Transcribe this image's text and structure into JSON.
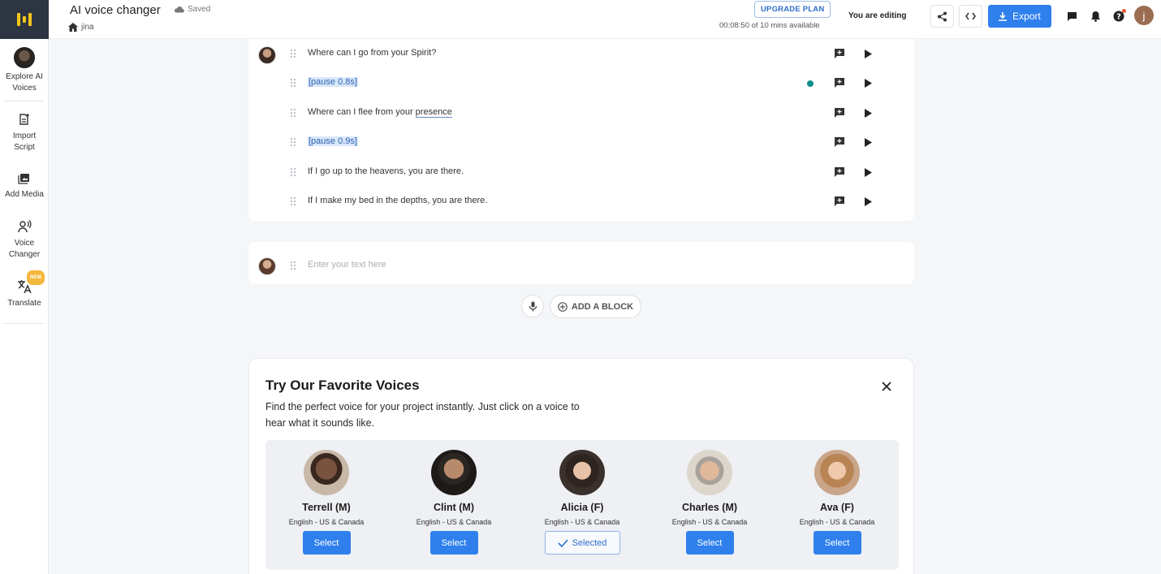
{
  "app": {
    "project_title": "AI voice changer",
    "save_status": "Saved",
    "breadcrumb_user": "jina"
  },
  "sidebar": {
    "items": [
      {
        "label": "Explore AI Voices",
        "icon": "voice-avatar-icon"
      },
      {
        "label": "Import Script",
        "icon": "import-script-icon"
      },
      {
        "label": "Add Media",
        "icon": "media-icon"
      },
      {
        "label": "Voice Changer",
        "icon": "voice-changer-icon"
      },
      {
        "label": "Translate",
        "icon": "translate-icon",
        "badge": "NEW"
      }
    ]
  },
  "header": {
    "upgrade_label": "UPGRADE PLAN",
    "time_available": "00:08:50 of 10 mins available",
    "editing_label": "You are editing",
    "export_label": "Export",
    "user_initial": "j"
  },
  "script": {
    "lines": [
      {
        "text": "Where can I go from your Spirit?"
      },
      {
        "text": "[pause 0.8s]",
        "pause": true
      },
      {
        "text_before": "Where can I flee from your ",
        "text_linked": "presence"
      },
      {
        "text": "[pause 0.9s]",
        "pause": true
      },
      {
        "text": "If I go up to the heavens, you are there."
      },
      {
        "text": "If I make my bed in the depths, you are there."
      }
    ],
    "new_block_placeholder": "Enter your text here",
    "add_block_label": "ADD A BLOCK"
  },
  "voices_panel": {
    "title": "Try Our Favorite Voices",
    "description": "Find the perfect voice for your project instantly. Just click on a voice to hear what it sounds like.",
    "voices": [
      {
        "name": "Terrell (M)",
        "lang": "English - US & Canada",
        "button": "Select"
      },
      {
        "name": "Clint (M)",
        "lang": "English - US & Canada",
        "button": "Select"
      },
      {
        "name": "Alicia (F)",
        "lang": "English - US & Canada",
        "button": "Selected"
      },
      {
        "name": "Charles (M)",
        "lang": "English - US & Canada",
        "button": "Select"
      },
      {
        "name": "Ava (F)",
        "lang": "English - US & Canada",
        "button": "Select"
      }
    ]
  },
  "colors": {
    "accent": "#2f80ed",
    "pause_highlight": "#d9e7f9",
    "sidebar_logo_bg": "#2d3543",
    "logo_yellow": "#f5c518"
  }
}
